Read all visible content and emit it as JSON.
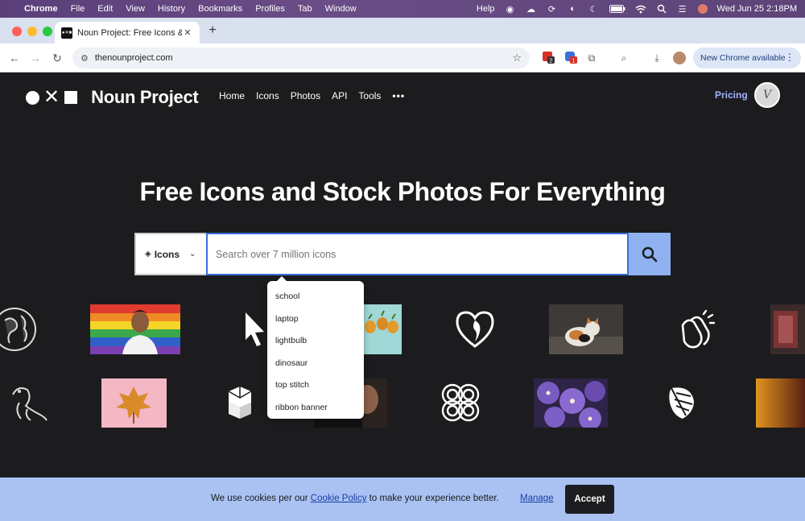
{
  "menubar": {
    "app": "Chrome",
    "items": [
      "File",
      "Edit",
      "View",
      "History",
      "Bookmarks",
      "Profiles",
      "Tab",
      "Window"
    ],
    "help": "Help",
    "datetime": "Wed Jun 25  2:18PM",
    "battery": "99"
  },
  "browser": {
    "tab_title": "Noun Project: Free Icons & St",
    "url": "thenounproject.com",
    "new_chrome": "New Chrome available",
    "ext_badge_1": "2",
    "ext_badge_2": "1"
  },
  "site": {
    "brand": "Noun Project",
    "nav": [
      "Home",
      "Icons",
      "Photos",
      "API",
      "Tools"
    ],
    "more": "•••",
    "pricing": "Pricing",
    "avatar_letter": "V"
  },
  "hero": {
    "title": "Free Icons and Stock Photos For Everything"
  },
  "search": {
    "type_label": "Icons",
    "placeholder": "Search over 7 million icons"
  },
  "suggestions": [
    "school",
    "laptop",
    "lightbulb",
    "dinosaur",
    "top stitch",
    "ribbon banner"
  ],
  "cookie": {
    "text_before": "We use cookies per our ",
    "link": "Cookie Policy",
    "text_after": " to make your experience better.",
    "manage": "Manage",
    "accept": "Accept"
  },
  "colors": {
    "page_bg": "#1c1c1f",
    "search_button": "#8fb1f0",
    "search_border_focus": "#3b6fd8",
    "cookie_bar": "#a9c2f2",
    "pricing": "#9fb4ff"
  }
}
